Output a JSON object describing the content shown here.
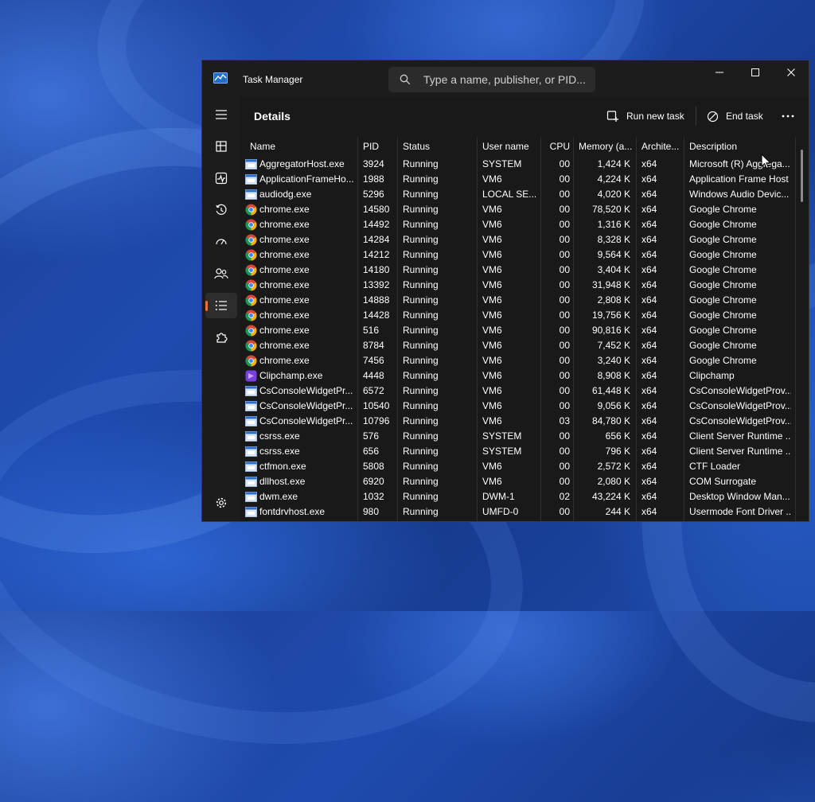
{
  "window": {
    "title": "Task Manager",
    "search_placeholder": "Type a name, publisher, or PID..."
  },
  "page": {
    "title": "Details",
    "commands": {
      "run_new_task": "Run new task",
      "end_task": "End task"
    }
  },
  "columns": [
    "Name",
    "PID",
    "Status",
    "User name",
    "CPU",
    "Memory (a...",
    "Archite...",
    "Description"
  ],
  "processes": [
    {
      "name": "AggregatorHost.exe",
      "pid": "3924",
      "status": "Running",
      "user": "SYSTEM",
      "cpu": "00",
      "memory": "1,424 K",
      "arch": "x64",
      "description": "Microsoft (R) Aggrega...",
      "icon": "window-icon"
    },
    {
      "name": "ApplicationFrameHo...",
      "pid": "1988",
      "status": "Running",
      "user": "VM6",
      "cpu": "00",
      "memory": "4,224 K",
      "arch": "x64",
      "description": "Application Frame Host",
      "icon": "window-icon"
    },
    {
      "name": "audiodg.exe",
      "pid": "5296",
      "status": "Running",
      "user": "LOCAL SE...",
      "cpu": "00",
      "memory": "4,020 K",
      "arch": "x64",
      "description": "Windows Audio Devic...",
      "icon": "window-icon"
    },
    {
      "name": "chrome.exe",
      "pid": "14580",
      "status": "Running",
      "user": "VM6",
      "cpu": "00",
      "memory": "78,520 K",
      "arch": "x64",
      "description": "Google Chrome",
      "icon": "chrome-icon"
    },
    {
      "name": "chrome.exe",
      "pid": "14492",
      "status": "Running",
      "user": "VM6",
      "cpu": "00",
      "memory": "1,316 K",
      "arch": "x64",
      "description": "Google Chrome",
      "icon": "chrome-icon"
    },
    {
      "name": "chrome.exe",
      "pid": "14284",
      "status": "Running",
      "user": "VM6",
      "cpu": "00",
      "memory": "8,328 K",
      "arch": "x64",
      "description": "Google Chrome",
      "icon": "chrome-icon"
    },
    {
      "name": "chrome.exe",
      "pid": "14212",
      "status": "Running",
      "user": "VM6",
      "cpu": "00",
      "memory": "9,564 K",
      "arch": "x64",
      "description": "Google Chrome",
      "icon": "chrome-icon"
    },
    {
      "name": "chrome.exe",
      "pid": "14180",
      "status": "Running",
      "user": "VM6",
      "cpu": "00",
      "memory": "3,404 K",
      "arch": "x64",
      "description": "Google Chrome",
      "icon": "chrome-icon"
    },
    {
      "name": "chrome.exe",
      "pid": "13392",
      "status": "Running",
      "user": "VM6",
      "cpu": "00",
      "memory": "31,948 K",
      "arch": "x64",
      "description": "Google Chrome",
      "icon": "chrome-icon"
    },
    {
      "name": "chrome.exe",
      "pid": "14888",
      "status": "Running",
      "user": "VM6",
      "cpu": "00",
      "memory": "2,808 K",
      "arch": "x64",
      "description": "Google Chrome",
      "icon": "chrome-icon"
    },
    {
      "name": "chrome.exe",
      "pid": "14428",
      "status": "Running",
      "user": "VM6",
      "cpu": "00",
      "memory": "19,756 K",
      "arch": "x64",
      "description": "Google Chrome",
      "icon": "chrome-icon"
    },
    {
      "name": "chrome.exe",
      "pid": "516",
      "status": "Running",
      "user": "VM6",
      "cpu": "00",
      "memory": "90,816 K",
      "arch": "x64",
      "description": "Google Chrome",
      "icon": "chrome-icon"
    },
    {
      "name": "chrome.exe",
      "pid": "8784",
      "status": "Running",
      "user": "VM6",
      "cpu": "00",
      "memory": "7,452 K",
      "arch": "x64",
      "description": "Google Chrome",
      "icon": "chrome-icon"
    },
    {
      "name": "chrome.exe",
      "pid": "7456",
      "status": "Running",
      "user": "VM6",
      "cpu": "00",
      "memory": "3,240 K",
      "arch": "x64",
      "description": "Google Chrome",
      "icon": "chrome-icon"
    },
    {
      "name": "Clipchamp.exe",
      "pid": "4448",
      "status": "Running",
      "user": "VM6",
      "cpu": "00",
      "memory": "8,908 K",
      "arch": "x64",
      "description": "Clipchamp",
      "icon": "clipchamp-icon"
    },
    {
      "name": "CsConsoleWidgetPr...",
      "pid": "6572",
      "status": "Running",
      "user": "VM6",
      "cpu": "00",
      "memory": "61,448 K",
      "arch": "x64",
      "description": "CsConsoleWidgetProv...",
      "icon": "window-icon"
    },
    {
      "name": "CsConsoleWidgetPr...",
      "pid": "10540",
      "status": "Running",
      "user": "VM6",
      "cpu": "00",
      "memory": "9,056 K",
      "arch": "x64",
      "description": "CsConsoleWidgetProv...",
      "icon": "window-icon"
    },
    {
      "name": "CsConsoleWidgetPr...",
      "pid": "10796",
      "status": "Running",
      "user": "VM6",
      "cpu": "03",
      "memory": "84,780 K",
      "arch": "x64",
      "description": "CsConsoleWidgetProv...",
      "icon": "window-icon"
    },
    {
      "name": "csrss.exe",
      "pid": "576",
      "status": "Running",
      "user": "SYSTEM",
      "cpu": "00",
      "memory": "656 K",
      "arch": "x64",
      "description": "Client Server Runtime ...",
      "icon": "window-icon"
    },
    {
      "name": "csrss.exe",
      "pid": "656",
      "status": "Running",
      "user": "SYSTEM",
      "cpu": "00",
      "memory": "796 K",
      "arch": "x64",
      "description": "Client Server Runtime ...",
      "icon": "window-icon"
    },
    {
      "name": "ctfmon.exe",
      "pid": "5808",
      "status": "Running",
      "user": "VM6",
      "cpu": "00",
      "memory": "2,572 K",
      "arch": "x64",
      "description": "CTF Loader",
      "icon": "window-icon"
    },
    {
      "name": "dllhost.exe",
      "pid": "6920",
      "status": "Running",
      "user": "VM6",
      "cpu": "00",
      "memory": "2,080 K",
      "arch": "x64",
      "description": "COM Surrogate",
      "icon": "window-icon"
    },
    {
      "name": "dwm.exe",
      "pid": "1032",
      "status": "Running",
      "user": "DWM-1",
      "cpu": "02",
      "memory": "43,224 K",
      "arch": "x64",
      "description": "Desktop Window Man...",
      "icon": "window-icon"
    },
    {
      "name": "fontdrvhost.exe",
      "pid": "980",
      "status": "Running",
      "user": "UMFD-0",
      "cpu": "00",
      "memory": "244 K",
      "arch": "x64",
      "description": "Usermode Font Driver ...",
      "icon": "window-icon"
    }
  ],
  "colors": {
    "accent": "#e8703a",
    "window_bg": "#1c1c1c",
    "content_bg": "#191919"
  }
}
